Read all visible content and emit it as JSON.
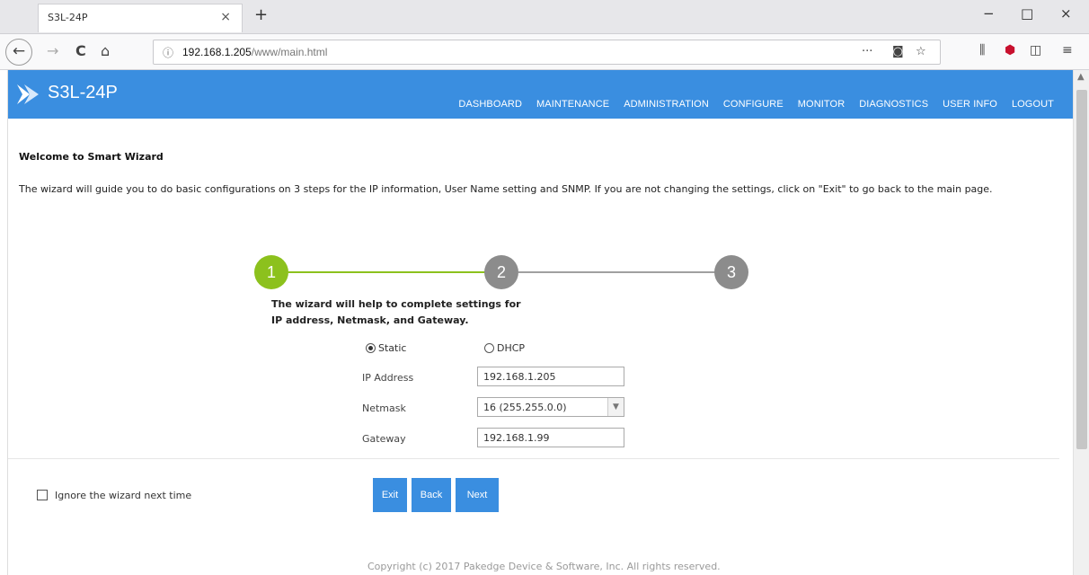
{
  "browser": {
    "tab_title": "S3L-24P",
    "tab_close": "×",
    "new_tab": "+",
    "url_host": "192.168.1.205",
    "url_path": "/www/main.html",
    "url_more": "···",
    "window_minimize": "−",
    "window_maximize": "□",
    "window_close": "×",
    "nav_back": "←",
    "nav_forward": "→",
    "nav_reload": "C",
    "nav_home": "⌂",
    "menu_icon": "≡"
  },
  "app": {
    "brand": "S3L-24P",
    "accent": "#3a8ee0",
    "menu": [
      "DASHBOARD",
      "MAINTENANCE",
      "ADMINISTRATION",
      "CONFIGURE",
      "MONITOR",
      "DIAGNOSTICS",
      "USER INFO",
      "LOGOUT"
    ]
  },
  "wizard": {
    "title": "Welcome to Smart Wizard",
    "description": "The wizard will guide you to do basic configurations on 3 steps for the IP information, User Name setting and SNMP.  If you are not changing the settings, click on \"Exit\" to go back to the main page.",
    "steps": [
      "1",
      "2",
      "3"
    ],
    "active_step": 1,
    "active_color": "#8cc11d",
    "inactive_color": "#8c8c8c",
    "intro_line1": "The wizard will help to complete settings for",
    "intro_line2": "IP address, Netmask, and Gateway.",
    "mode_options": [
      "Static",
      "DHCP"
    ],
    "mode_selected": "Static",
    "fields": {
      "ip_label": "IP Address",
      "ip_value": "192.168.1.205",
      "netmask_label": "Netmask",
      "netmask_value": "16 (255.255.0.0)",
      "gateway_label": "Gateway",
      "gateway_value": "192.168.1.99"
    },
    "ignore_label": "Ignore the wizard next time",
    "buttons": {
      "exit": "Exit",
      "back": "Back",
      "next": "Next"
    }
  },
  "footer": {
    "copyright": "Copyright (c) 2017 Pakedge Device & Software, Inc. All rights reserved."
  }
}
